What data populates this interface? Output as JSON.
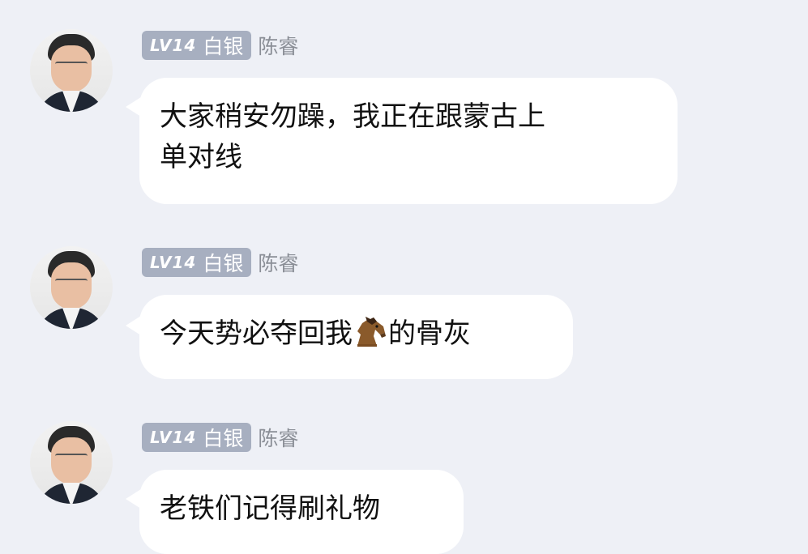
{
  "messages": [
    {
      "level": "LV14",
      "rank": "白银",
      "sender": "陈睿",
      "text_line1": "大家稍安勿躁，我正在跟蒙古上",
      "text_line2": "单对线"
    },
    {
      "level": "LV14",
      "rank": "白银",
      "sender": "陈睿",
      "text_before_emoji": "今天势必夺回我",
      "emoji": "horse-icon",
      "text_after_emoji": "的骨灰"
    },
    {
      "level": "LV14",
      "rank": "白银",
      "sender": "陈睿",
      "text": "老铁们记得刷礼物"
    }
  ]
}
